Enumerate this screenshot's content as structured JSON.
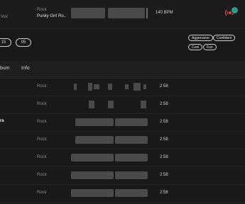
{
  "top": {
    "genre": "Rock",
    "title": "Punky Grrl Ro..",
    "bpm": "140 BPM",
    "left_label": "Vox"
  },
  "tags": [
    "Aggressive",
    "Confident",
    "Cool",
    "Fun"
  ],
  "range_pills": [
    "15",
    "05"
  ],
  "columns": {
    "album": "bum",
    "info": "Info"
  },
  "rows": [
    {
      "left": "",
      "genre": "Rock",
      "time": "2:58"
    },
    {
      "left": "",
      "genre": "Rock",
      "time": "2:58"
    },
    {
      "left": "rs",
      "genre": "Rock",
      "time": "2:58"
    },
    {
      "left": "",
      "genre": "Rock",
      "time": "2:58"
    },
    {
      "left": "",
      "genre": "Rock",
      "time": "2:58"
    },
    {
      "left": "",
      "genre": "Rock",
      "time": "2:58"
    },
    {
      "left": "",
      "genre": "Rock",
      "time": "2:58"
    }
  ],
  "icons": {
    "stems": "stems-icon",
    "badge": "brand-badge-icon"
  },
  "colors": {
    "bg": "#191919",
    "accent": "#e0453a",
    "badge": "#2e9c86"
  }
}
